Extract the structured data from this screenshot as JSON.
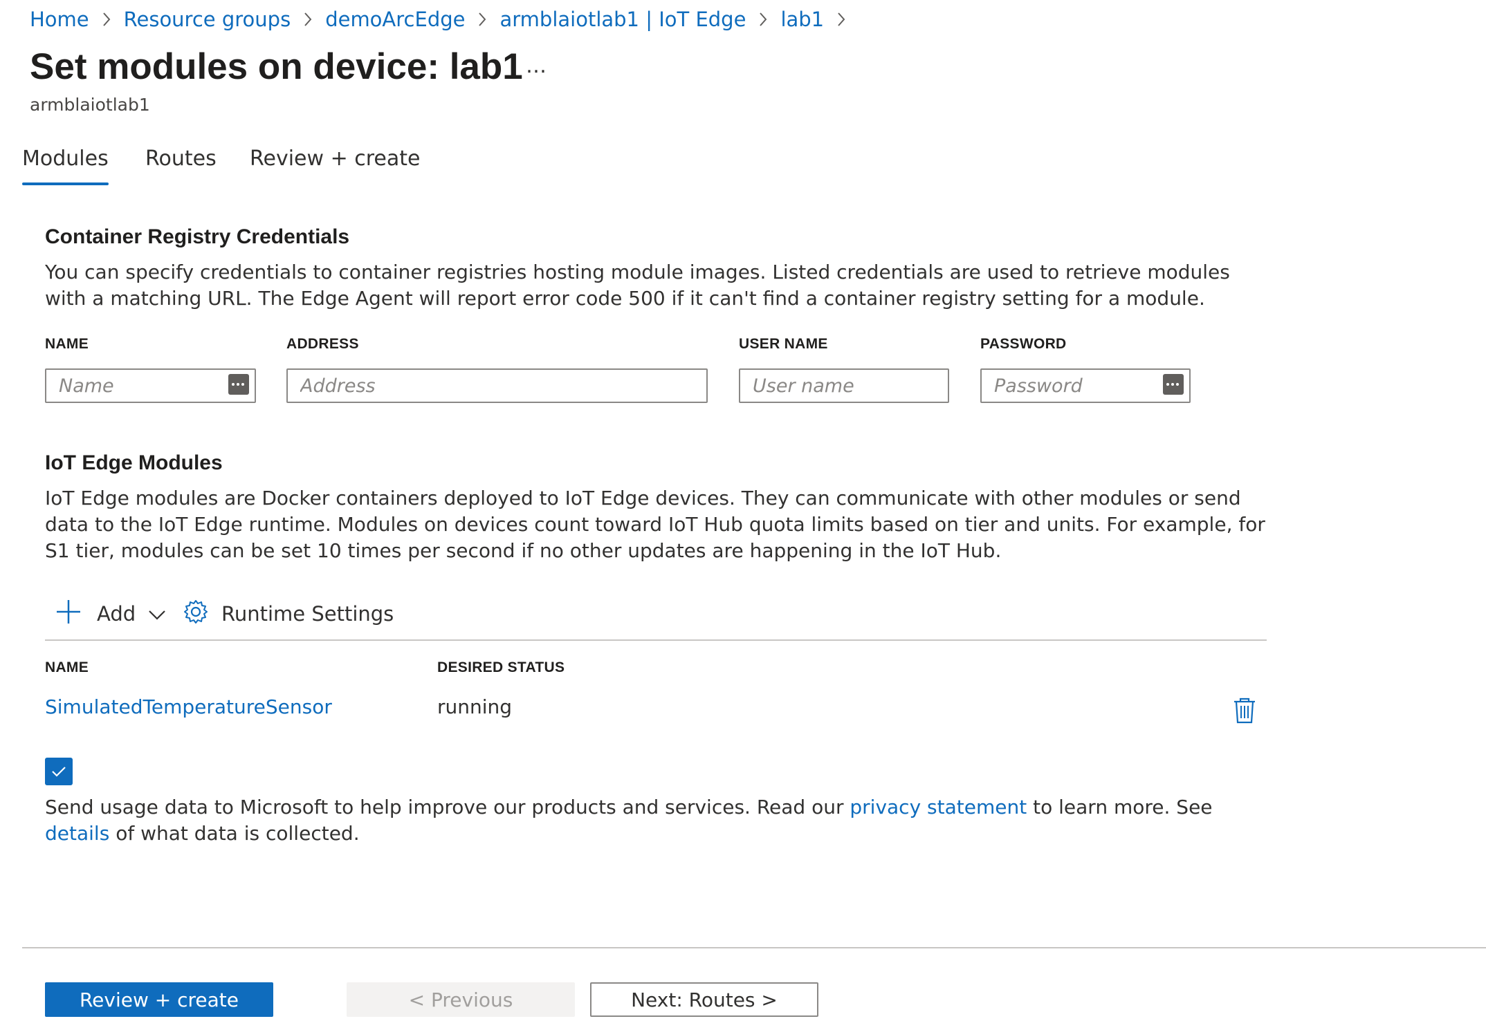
{
  "breadcrumb": [
    "Home",
    "Resource groups",
    "demoArcEdge",
    "armblaiotlab1 | IoT Edge",
    "lab1"
  ],
  "page": {
    "title": "Set modules on device: lab1",
    "more_label": "…",
    "subtitle": "armblaiotlab1"
  },
  "tabs": [
    {
      "label": "Modules",
      "active": true
    },
    {
      "label": "Routes",
      "active": false
    },
    {
      "label": "Review + create",
      "active": false
    }
  ],
  "registry": {
    "heading": "Container Registry Credentials",
    "description": "You can specify credentials to container registries hosting module images. Listed credentials are used to retrieve modules with a matching URL. The Edge Agent will report error code 500 if it can't find a container registry setting for a module.",
    "columns": [
      "NAME",
      "ADDRESS",
      "USER NAME",
      "PASSWORD"
    ],
    "placeholders": {
      "name": "Name",
      "address": "Address",
      "username": "User name",
      "password": "Password"
    }
  },
  "modules": {
    "heading": "IoT Edge Modules",
    "description": "IoT Edge modules are Docker containers deployed to IoT Edge devices. They can communicate with other modules or send data to the IoT Edge runtime. Modules on devices count toward IoT Hub quota limits based on tier and units. For example, for S1 tier, modules can be set 10 times per second if no other updates are happening in the IoT Hub.",
    "toolbar": {
      "add_label": "Add",
      "runtime_label": "Runtime Settings"
    },
    "columns": [
      "NAME",
      "DESIRED STATUS"
    ],
    "rows": [
      {
        "name": "SimulatedTemperatureSensor",
        "status": "running"
      }
    ]
  },
  "consent": {
    "checked": true,
    "text_before": "Send usage data to Microsoft to help improve our products and services. Read our ",
    "privacy_link": "privacy statement",
    "text_middle": " to learn more. See ",
    "details_link": "details",
    "text_after": " of what data is collected."
  },
  "footer": {
    "review_label": "Review + create",
    "previous_label": "< Previous",
    "next_label": "Next: Routes >"
  },
  "colors": {
    "accent": "#0f6cbd",
    "text": "#323130",
    "border": "#8a8886"
  }
}
